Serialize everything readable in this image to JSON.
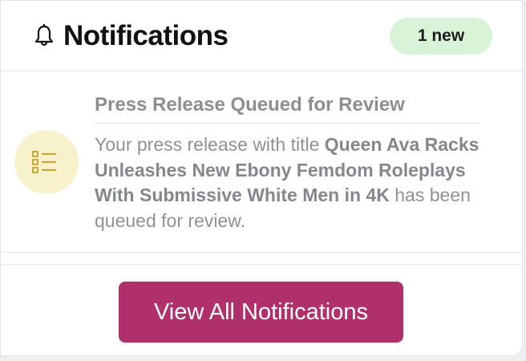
{
  "header": {
    "icon": "bell-icon",
    "title": "Notifications",
    "badge": "1 new",
    "badge_color": "#d9f3d9"
  },
  "notifications": [
    {
      "icon": "list-icon",
      "icon_bg": "#f8f2cc",
      "icon_color": "#c9a93a",
      "title": "Press Release Queued for Review",
      "body_prefix": "Your press release with title ",
      "body_bold": "Queen Ava Racks Unleashes New Ebony Femdom Roleplays With Submissive White Men in 4K",
      "body_suffix": " has been queued for review."
    }
  ],
  "footer": {
    "button_label": "View All Notifications",
    "button_color": "#b0306b"
  }
}
